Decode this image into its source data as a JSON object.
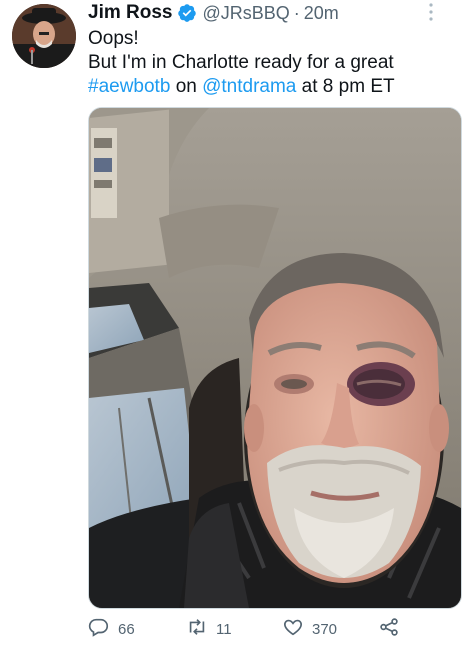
{
  "tweet": {
    "author_name": "Jim Ross",
    "handle": "@JRsBBQ",
    "separator": "·",
    "time": "20m",
    "text_line1": "Oops!",
    "text_line2": "But I'm in Charlotte ready for a great",
    "hashtag": "#aewbotb",
    "on_word": "on",
    "mention": "@tntdrama",
    "tail": "at 8 pm ET"
  },
  "actions": {
    "replies": "66",
    "retweets": "11",
    "likes": "370"
  },
  "icons": {
    "verified": "verified-badge-icon",
    "more": "more-vertical-icon",
    "reply": "reply-icon",
    "retweet": "retweet-icon",
    "like": "heart-icon",
    "share": "share-icon"
  },
  "colors": {
    "link": "#1d9bf0",
    "secondary_text": "#536471",
    "primary_text": "#0f1419"
  }
}
